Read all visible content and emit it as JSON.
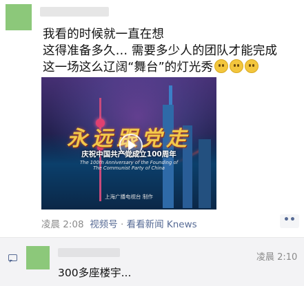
{
  "post": {
    "lines": [
      "我看的时候就一直在想",
      "这得准备多久… 需要多少人的团队才能完成",
      "这一场这么辽阔“舞台”的灯光秀"
    ],
    "emojis": [
      "crying-face-icon",
      "crying-face-icon",
      "crying-face-icon"
    ],
    "video": {
      "title": "永远跟党走",
      "subtitle": "庆祝中国共产党成立100周年",
      "subtitle_en_1": "The 100th Anniversary of the Founding of",
      "subtitle_en_2": "The Communist Party of China",
      "credit": "上海广播电视台 制作"
    },
    "time": "凌晨 2:08",
    "channel": "视频号",
    "separator": "·",
    "source": "看看新闻 Knews",
    "more_label": "••"
  },
  "comment": {
    "time": "凌晨 2:10",
    "text": "300多座楼宇..."
  },
  "colors": {
    "link": "#576b95",
    "avatar": "#8cc87a",
    "comment_bg": "#f3f3f5"
  }
}
